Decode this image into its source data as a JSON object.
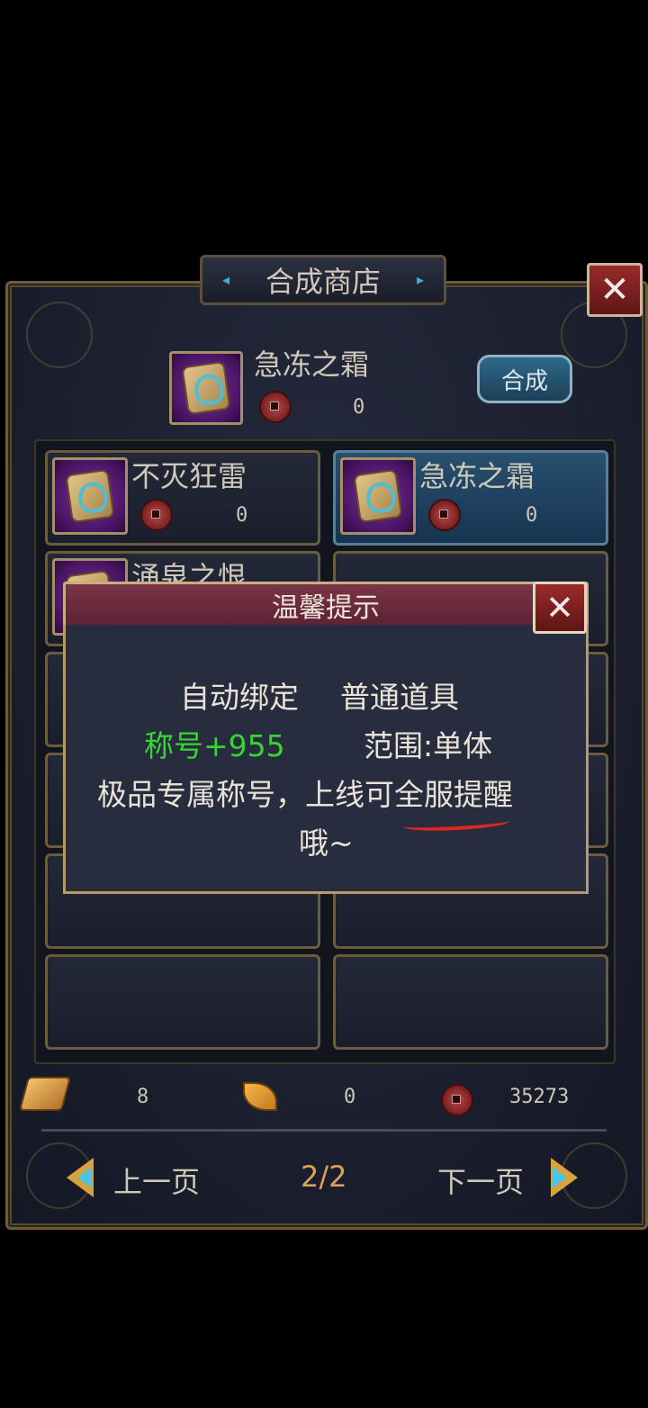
{
  "shop": {
    "title": "合成商店",
    "close_icon": "close-icon"
  },
  "selected": {
    "name": "急冻之霜",
    "cost": "0",
    "compose_label": "合成"
  },
  "grid": {
    "items": [
      {
        "name": "不灭狂雷",
        "cost": "0"
      },
      {
        "name": "急冻之霜",
        "cost": "0"
      },
      {
        "name": "涌泉之恨"
      }
    ]
  },
  "dialog": {
    "title": "温馨提示",
    "line1_a": "自动绑定",
    "line1_b": "普通道具",
    "line2_a": "称号+955",
    "line2_b": "范围:单体",
    "line3": "极品专属称号，上线可全服提醒",
    "line4": "哦~"
  },
  "currency": {
    "gold": "8",
    "leaf": "0",
    "coin": "35273"
  },
  "pager": {
    "prev": "上一页",
    "page": "2/2",
    "next": "下一页"
  },
  "colors": {
    "accent_green": "#38d432",
    "underline_red": "#e0261f"
  }
}
